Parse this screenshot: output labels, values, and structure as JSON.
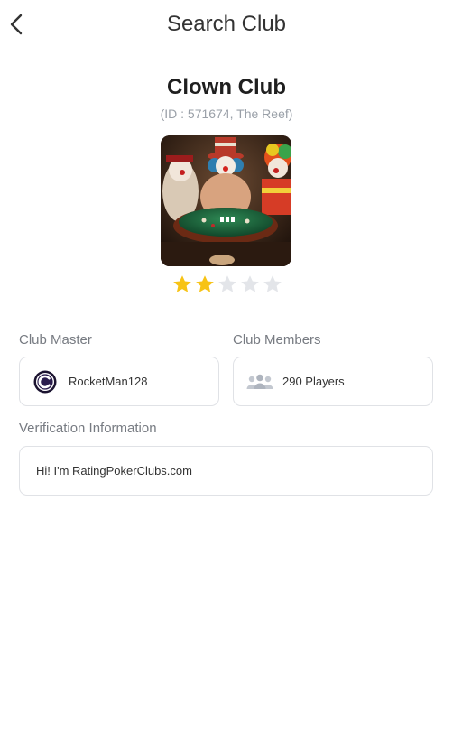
{
  "header": {
    "title": "Search Club",
    "back_icon": "chevron-left-icon"
  },
  "club": {
    "name": "Clown Club",
    "id_text": "(ID : 571674, The Reef)",
    "rating": 2,
    "rating_max": 5
  },
  "master": {
    "label": "Club Master",
    "name": "RocketMan128"
  },
  "members": {
    "label": "Club Members",
    "count_text": "290 Players"
  },
  "verification": {
    "label": "Verification Information",
    "text": "Hi! I'm RatingPokerClubs.com"
  },
  "colors": {
    "star_filled": "#f7c315",
    "star_empty": "#e3e5e9",
    "label_gray": "#777b82",
    "border": "#e0e2e6"
  }
}
